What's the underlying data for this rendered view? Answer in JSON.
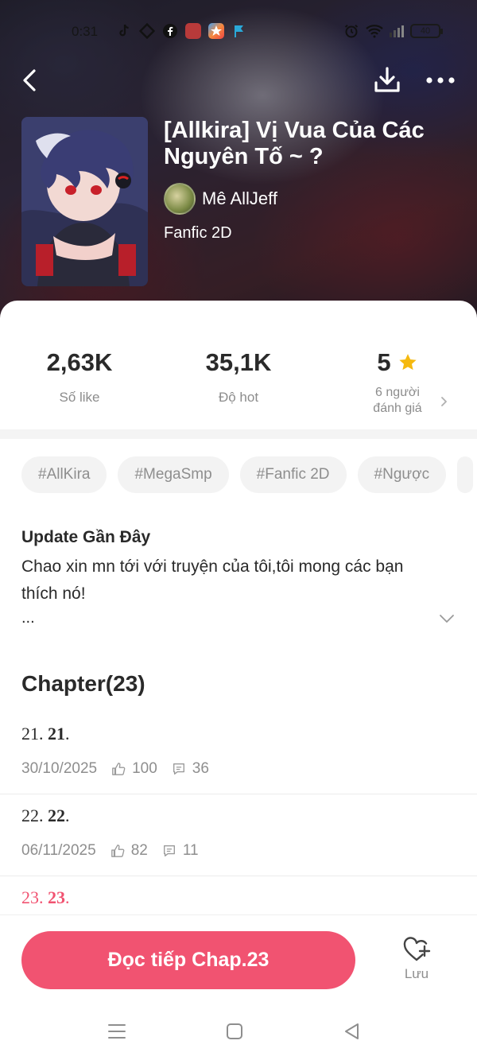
{
  "status_bar": {
    "time": "0:31",
    "battery": "40"
  },
  "story": {
    "title": "[Allkira] Vị Vua Của Các Nguyên Tố ~ ?",
    "author": "Mê AllJeff",
    "genre": "Fanfic 2D"
  },
  "stats": {
    "likes_value": "2,63K",
    "likes_label": "Số like",
    "hot_value": "35,1K",
    "hot_label": "Độ hot",
    "rating_value": "5",
    "rating_label_line1": "6 người",
    "rating_label_line2": "đánh giá"
  },
  "tags": [
    "#AllKira",
    "#MegaSmp",
    "#Fanfic 2D",
    "#Ngược"
  ],
  "update": {
    "title": "Update Gần Đây",
    "text": "Chao xin mn tới với truyện của tôi,tôi mong các bạn thích nó!",
    "ellipsis": "..."
  },
  "chapters": {
    "title": "Chapter(23)",
    "items": [
      {
        "prefix": "21. ",
        "number": "21",
        "suffix": ".",
        "date": "30/10/2025",
        "likes": "100",
        "comments": "36"
      },
      {
        "prefix": "22. ",
        "number": "22",
        "suffix": ".",
        "date": "06/11/2025",
        "likes": "82",
        "comments": "11"
      },
      {
        "prefix": "23. ",
        "number": "23",
        "suffix": "."
      }
    ]
  },
  "bottom": {
    "read_button": "Đọc tiếp Chap.23",
    "save_label": "Lưu"
  },
  "colors": {
    "accent": "#f15371",
    "star": "#f5b90f",
    "muted_text": "#8e8e8e",
    "tag_bg": "#f3f3f3"
  }
}
